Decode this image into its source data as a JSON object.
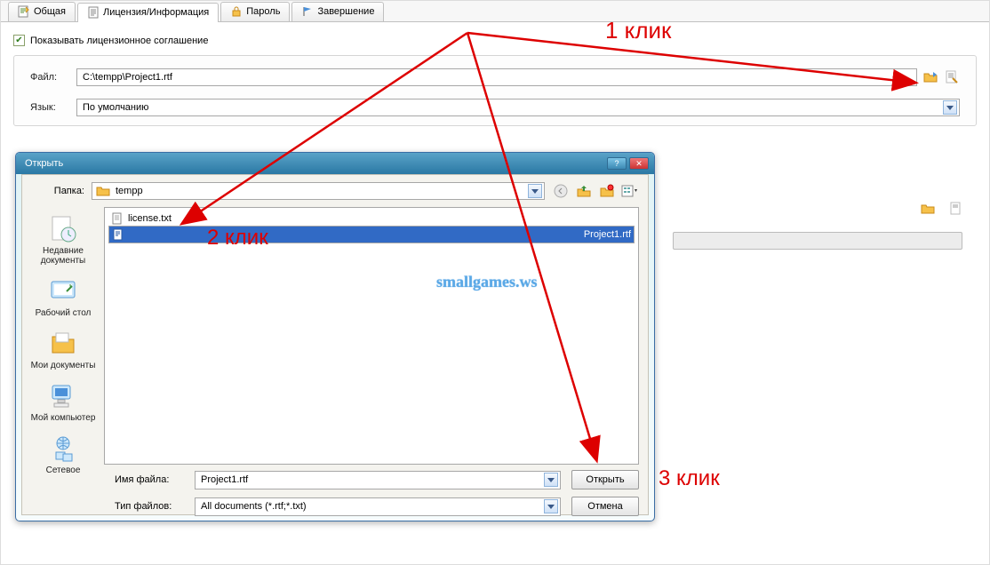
{
  "tabs": [
    {
      "label": "Общая"
    },
    {
      "label": "Лицензия/Информация"
    },
    {
      "label": "Пароль"
    },
    {
      "label": "Завершение"
    }
  ],
  "checkbox_label": "Показывать лицензионное соглашение",
  "file_label": "Файл:",
  "file_value": "C:\\tempp\\Project1.rtf",
  "lang_label": "Язык:",
  "lang_value": "По умолчанию",
  "dialog": {
    "title": "Открыть",
    "folder_label": "Папка:",
    "folder_value": "tempp",
    "places": [
      {
        "label": "Недавние документы"
      },
      {
        "label": "Рабочий стол"
      },
      {
        "label": "Мои документы"
      },
      {
        "label": "Мой компьютер"
      },
      {
        "label": "Сетевое"
      }
    ],
    "files": [
      {
        "name": "license.txt",
        "selected": false
      },
      {
        "name": "Project1.rtf",
        "selected": true
      }
    ],
    "filename_label": "Имя файла:",
    "filename_value": "Project1.rtf",
    "filetype_label": "Тип файлов:",
    "filetype_value": "All documents (*.rtf;*.txt)",
    "open_btn": "Открыть",
    "cancel_btn": "Отмена"
  },
  "annotations": {
    "a1": "1 клик",
    "a2": "2 клик",
    "a3": "3 клик",
    "watermark": "smallgames.ws"
  }
}
